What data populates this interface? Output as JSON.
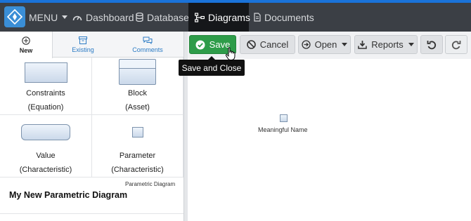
{
  "nav": {
    "menu_label": "MENU",
    "items": [
      {
        "label": "Dashboard"
      },
      {
        "label": "Database"
      },
      {
        "label": "Diagrams"
      },
      {
        "label": "Documents"
      }
    ]
  },
  "palette_tabs": [
    {
      "label": "New"
    },
    {
      "label": "Existing"
    },
    {
      "label": "Comments"
    }
  ],
  "palette": [
    {
      "line1": "Constraints",
      "line2": "(Equation)"
    },
    {
      "line1": "Block",
      "line2": "(Asset)"
    },
    {
      "line1": "Value",
      "line2": "(Characteristic)"
    },
    {
      "line1": "Parameter",
      "line2": "(Characteristic)"
    }
  ],
  "diagram": {
    "type_caption": "Parametric Diagram",
    "name": "My New Parametric Diagram"
  },
  "toolbar": {
    "save": "Save",
    "cancel": "Cancel",
    "open": "Open",
    "reports": "Reports",
    "tooltip": "Save and Close"
  },
  "canvas": {
    "node_label": "Meaningful Name"
  },
  "colors": {
    "nav_bg": "#3b3f45",
    "nav_accent": "#1a73d9",
    "save_green": "#2e9c49"
  }
}
